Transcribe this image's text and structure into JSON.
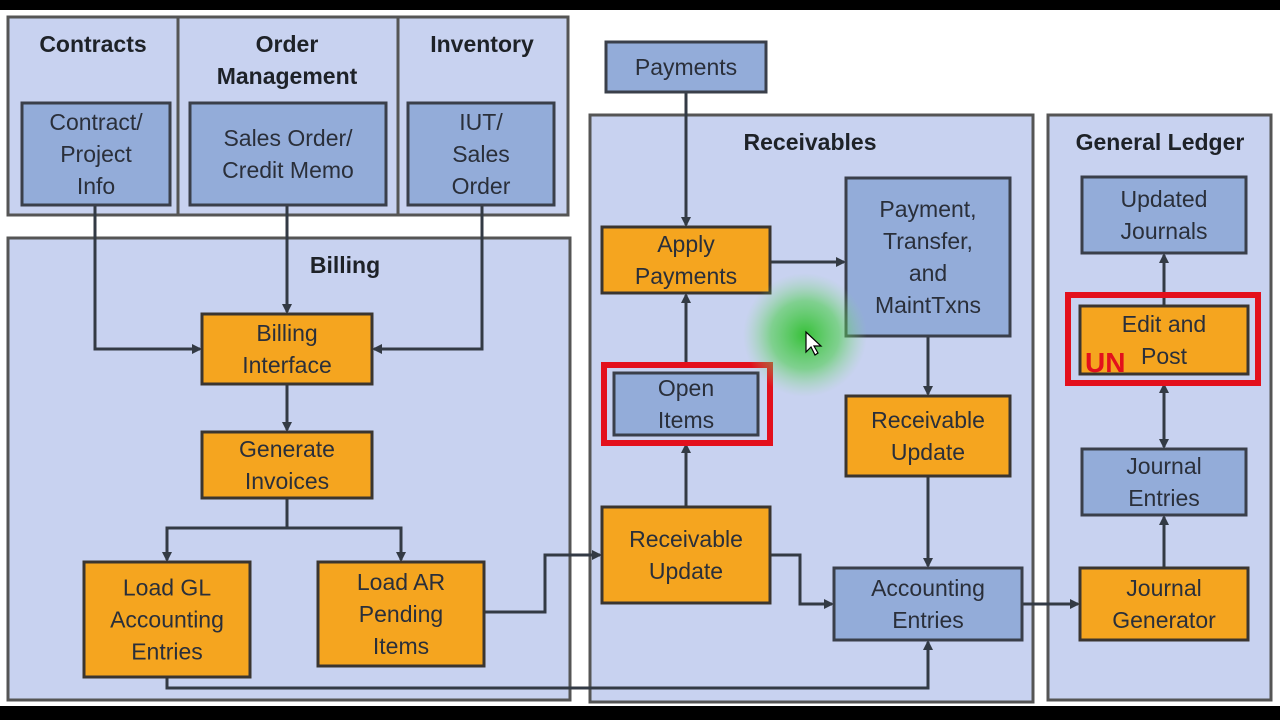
{
  "colors": {
    "panel": "#c8d2f0",
    "blue_box": "#93acd9",
    "orange_box": "#f5a51f",
    "highlight": "#e3101c",
    "cursor_glow": "#2fbf2f"
  },
  "sections": {
    "contracts": "Contracts",
    "order_management": [
      "Order",
      "Management"
    ],
    "inventory": "Inventory",
    "billing": "Billing",
    "receivables": "Receivables",
    "general_ledger": "General Ledger"
  },
  "boxes": {
    "contract_project_info": [
      "Contract/",
      "Project",
      "Info"
    ],
    "sales_order_credit_memo": [
      "Sales Order/",
      "Credit Memo"
    ],
    "iut_sales_order": [
      "IUT/",
      "Sales",
      "Order"
    ],
    "billing_interface": [
      "Billing",
      "Interface"
    ],
    "generate_invoices": [
      "Generate",
      "Invoices"
    ],
    "load_gl_accounting_entries": [
      "Load GL",
      "Accounting",
      "Entries"
    ],
    "load_ar_pending_items": [
      "Load AR",
      "Pending",
      "Items"
    ],
    "payments": [
      "Payments"
    ],
    "apply_payments": [
      "Apply",
      "Payments"
    ],
    "payment_transfer_maint": [
      "Payment,",
      "Transfer,",
      "and",
      "MaintTxns"
    ],
    "open_items": [
      "Open",
      "Items"
    ],
    "receivable_update_right": [
      "Receivable",
      "Update"
    ],
    "receivable_update_left": [
      "Receivable",
      "Update"
    ],
    "accounting_entries": [
      "Accounting",
      "Entries"
    ],
    "updated_journals": [
      "Updated",
      "Journals"
    ],
    "edit_and_post": [
      "Edit and",
      "Post"
    ],
    "journal_entries": [
      "Journal",
      "Entries"
    ],
    "journal_generator": [
      "Journal",
      "Generator"
    ]
  },
  "annotation": {
    "un_prefix": "UN"
  },
  "highlighted": [
    "open_items",
    "edit_and_post"
  ],
  "cursor_icon": "mouse-pointer"
}
